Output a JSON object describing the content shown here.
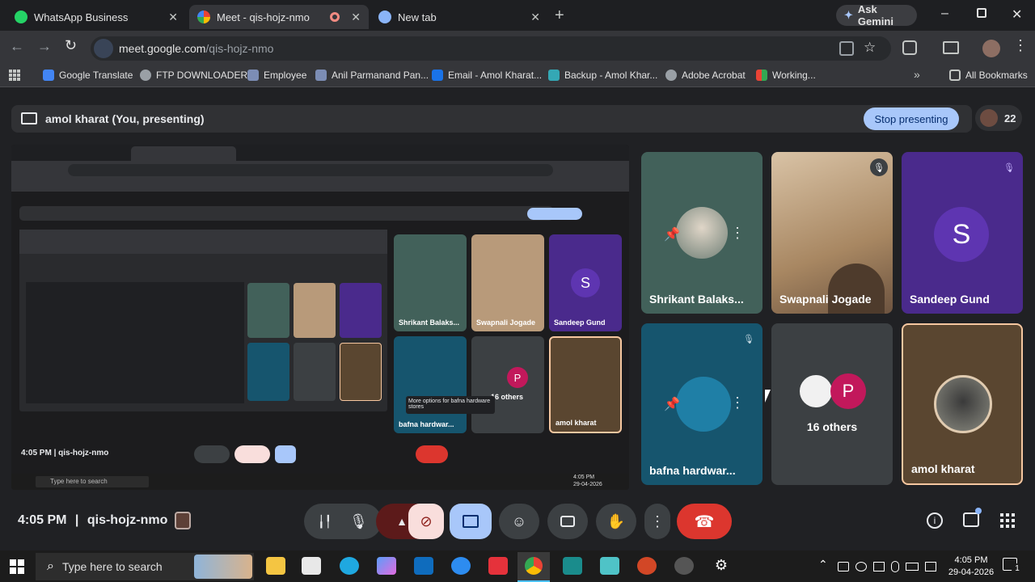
{
  "browser": {
    "tabs": [
      {
        "title": "WhatsApp Business"
      },
      {
        "title": "Meet - qis-hojz-nmo"
      },
      {
        "title": "New tab"
      }
    ],
    "ask_gemini": "Ask Gemini",
    "url_host": "meet.google.com",
    "url_path": "/qis-hojz-nmo",
    "bookmarks": [
      "Google Translate",
      "FTP DOWNLOADER",
      "Employee",
      "Anil Parmanand Pan...",
      "Email - Amol Kharat...",
      "Backup - Amol Khar...",
      "Adobe Acrobat",
      "Working..."
    ],
    "all_bookmarks": "All Bookmarks"
  },
  "meet": {
    "presenting_label": "amol kharat (You, presenting)",
    "stop_presenting": "Stop presenting",
    "participant_count": "22",
    "time": "4:05 PM",
    "separator": "|",
    "meeting_code": "qis-hojz-nmo",
    "tiles": [
      {
        "name": "Shrikant Balaks...",
        "color": "#42615a"
      },
      {
        "name": "Swapnali Jogade",
        "color": "#b89a7a"
      },
      {
        "name": "Sandeep Gund",
        "color": "#4a2a8c",
        "initial": "S"
      },
      {
        "name": "bafna hardwar...",
        "color": "#16556e"
      },
      {
        "name": "16 others",
        "color": "#3c4043",
        "initial": "P"
      },
      {
        "name": "amol kharat",
        "color": "#5a4630"
      }
    ],
    "mini_tooltip": "More options for bafna hardware stores"
  },
  "taskbar": {
    "search_placeholder": "Type here to search",
    "time": "4:05 PM",
    "date": "29-04-2026",
    "notification_count": "1"
  },
  "colors": {
    "accent_blue": "#a8c7fa",
    "end_call_red": "#dc362e",
    "sandeep_purple": "#4a2a8c",
    "avatar_p": "#c2185b"
  }
}
